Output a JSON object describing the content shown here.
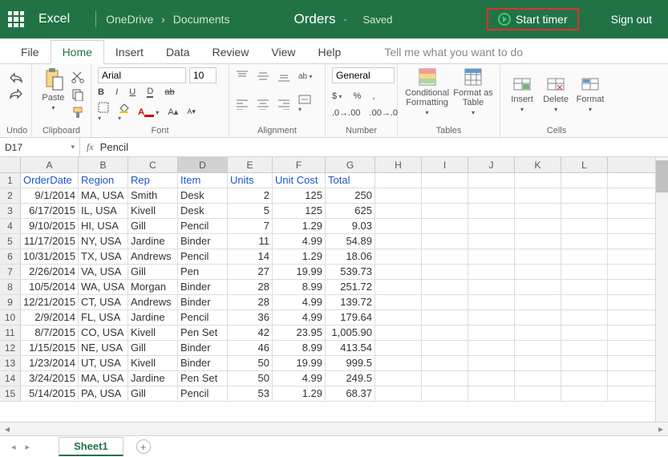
{
  "header": {
    "app": "Excel",
    "bc1": "OneDrive",
    "bc2": "Documents",
    "doc": "Orders",
    "dash": "-",
    "saved": "Saved",
    "start_timer": "Start timer",
    "signout": "Sign out"
  },
  "menu": {
    "file": "File",
    "home": "Home",
    "insert": "Insert",
    "data": "Data",
    "review": "Review",
    "view": "View",
    "help": "Help",
    "tellme": "Tell me what you want to do"
  },
  "ribbon": {
    "undo": "Undo",
    "clipboard": "Clipboard",
    "paste": "Paste",
    "font": {
      "name": "Arial",
      "size": "10",
      "group": "Font"
    },
    "alignment": "Alignment",
    "number": {
      "format": "General",
      "group": "Number"
    },
    "cond_fmt": "Conditional Formatting",
    "fmt_table": "Format as Table",
    "tables": "Tables",
    "insert": "Insert",
    "delete": "Delete",
    "format": "Format",
    "cells": "Cells"
  },
  "fx": {
    "cell": "D17",
    "value": "Pencil"
  },
  "grid": {
    "cols": [
      "A",
      "B",
      "C",
      "D",
      "E",
      "F",
      "G",
      "H",
      "I",
      "J",
      "K",
      "L"
    ],
    "headers": [
      "OrderDate",
      "Region",
      "Rep",
      "Item",
      "Units",
      "Unit Cost",
      "Total"
    ],
    "rows": [
      {
        "n": "2",
        "c": [
          "9/1/2014",
          "MA, USA",
          "Smith",
          "Desk",
          "2",
          "125",
          "250"
        ]
      },
      {
        "n": "3",
        "c": [
          "6/17/2015",
          "IL, USA",
          "Kivell",
          "Desk",
          "5",
          "125",
          "625"
        ]
      },
      {
        "n": "4",
        "c": [
          "9/10/2015",
          "HI, USA",
          "Gill",
          "Pencil",
          "7",
          "1.29",
          "9.03"
        ]
      },
      {
        "n": "5",
        "c": [
          "11/17/2015",
          "NY, USA",
          "Jardine",
          "Binder",
          "11",
          "4.99",
          "54.89"
        ]
      },
      {
        "n": "6",
        "c": [
          "10/31/2015",
          "TX, USA",
          "Andrews",
          "Pencil",
          "14",
          "1.29",
          "18.06"
        ]
      },
      {
        "n": "7",
        "c": [
          "2/26/2014",
          "VA, USA",
          "Gill",
          "Pen",
          "27",
          "19.99",
          "539.73"
        ]
      },
      {
        "n": "8",
        "c": [
          "10/5/2014",
          "WA, USA",
          "Morgan",
          "Binder",
          "28",
          "8.99",
          "251.72"
        ]
      },
      {
        "n": "9",
        "c": [
          "12/21/2015",
          "CT, USA",
          "Andrews",
          "Binder",
          "28",
          "4.99",
          "139.72"
        ]
      },
      {
        "n": "10",
        "c": [
          "2/9/2014",
          "FL, USA",
          "Jardine",
          "Pencil",
          "36",
          "4.99",
          "179.64"
        ]
      },
      {
        "n": "11",
        "c": [
          "8/7/2015",
          "CO, USA",
          "Kivell",
          "Pen Set",
          "42",
          "23.95",
          "1,005.90"
        ]
      },
      {
        "n": "12",
        "c": [
          "1/15/2015",
          "NE, USA",
          "Gill",
          "Binder",
          "46",
          "8.99",
          "413.54"
        ]
      },
      {
        "n": "13",
        "c": [
          "1/23/2014",
          "UT, USA",
          "Kivell",
          "Binder",
          "50",
          "19.99",
          "999.5"
        ]
      },
      {
        "n": "14",
        "c": [
          "3/24/2015",
          "MA, USA",
          "Jardine",
          "Pen Set",
          "50",
          "4.99",
          "249.5"
        ]
      },
      {
        "n": "15",
        "c": [
          "5/14/2015",
          "PA, USA",
          "Gill",
          "Pencil",
          "53",
          "1.29",
          "68.37"
        ]
      }
    ]
  },
  "sheets": {
    "sheet1": "Sheet1"
  }
}
